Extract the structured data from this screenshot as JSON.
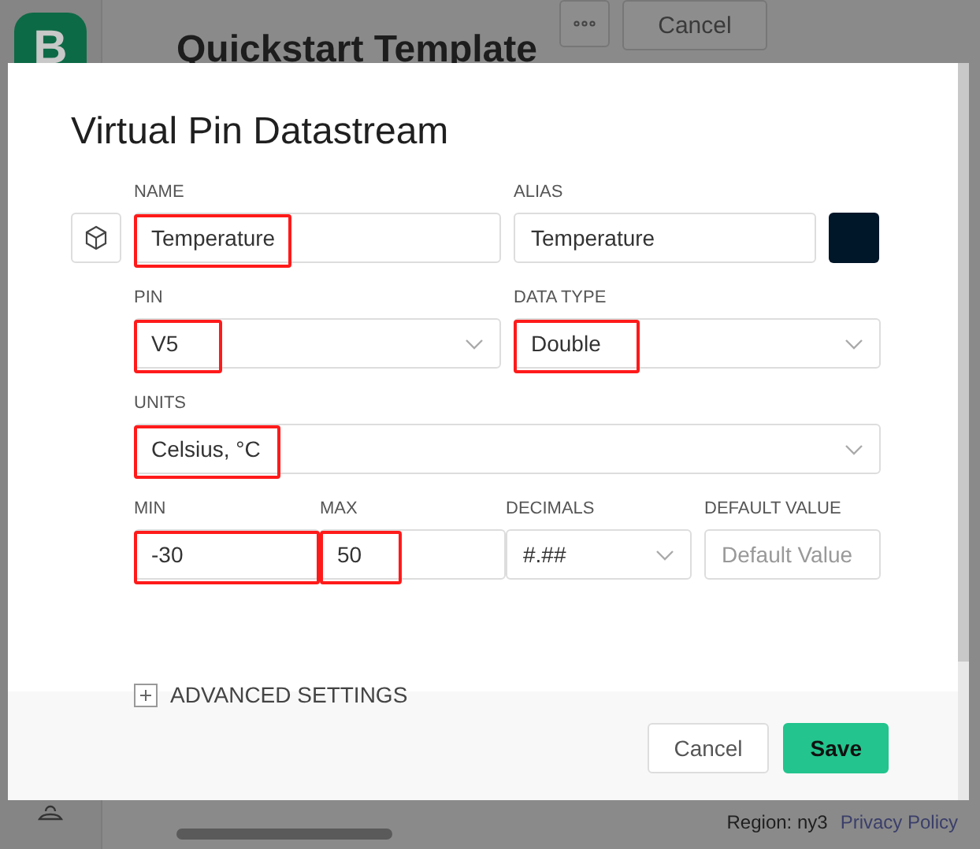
{
  "background": {
    "logo": "B",
    "title": "Quickstart Template",
    "cancel": "Cancel",
    "region": "Region: ny3",
    "privacy": "Privacy Policy"
  },
  "dialog": {
    "title": "Virtual Pin Datastream",
    "name": {
      "label": "NAME",
      "value": "Temperature",
      "highlighted": true
    },
    "alias": {
      "label": "ALIAS",
      "value": "Temperature"
    },
    "color": "#001629",
    "pin": {
      "label": "PIN",
      "value": "V5",
      "highlighted": true
    },
    "data_type": {
      "label": "DATA TYPE",
      "value": "Double",
      "highlighted": true
    },
    "units": {
      "label": "UNITS",
      "value": "Celsius, °C",
      "highlighted": true
    },
    "min": {
      "label": "MIN",
      "value": "-30",
      "highlighted": true
    },
    "max": {
      "label": "MAX",
      "value": "50",
      "highlighted": true
    },
    "decimals": {
      "label": "DECIMALS",
      "value": "#.##"
    },
    "default_value": {
      "label": "DEFAULT VALUE",
      "placeholder": "Default Value"
    },
    "advanced": {
      "label": "ADVANCED SETTINGS",
      "expanded": false
    },
    "buttons": [
      {
        "label": "Cancel",
        "kind": "secondary"
      },
      {
        "label": "Save",
        "kind": "primary"
      }
    ]
  }
}
